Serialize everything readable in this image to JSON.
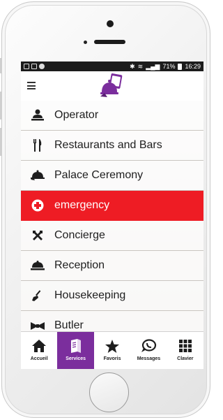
{
  "status_bar": {
    "battery": "71%",
    "time": "16:29"
  },
  "app": {
    "logo_icon": "concierge-bell-logo-icon",
    "accent_color": "#7b2e9d",
    "emergency_color": "#ee1c24"
  },
  "services": [
    {
      "label": "Operator",
      "icon": "operator-icon"
    },
    {
      "label": "Restaurants and Bars",
      "icon": "fork-knife-icon"
    },
    {
      "label": "Palace Ceremony",
      "icon": "serving-tray-icon"
    },
    {
      "label": "emergency",
      "icon": "medical-cross-icon",
      "active": true
    },
    {
      "label": "Concierge",
      "icon": "tools-icon"
    },
    {
      "label": "Reception",
      "icon": "bell-icon"
    },
    {
      "label": "Housekeeping",
      "icon": "broom-icon"
    },
    {
      "label": "Butler",
      "icon": "bow-tie-icon"
    }
  ],
  "tabs": [
    {
      "label": "Accueil",
      "icon": "home-icon"
    },
    {
      "label": "Services",
      "icon": "book-icon",
      "active": true
    },
    {
      "label": "Favoris",
      "icon": "star-icon"
    },
    {
      "label": "Messages",
      "icon": "chat-icon"
    },
    {
      "label": "Clavier",
      "icon": "keypad-icon"
    }
  ]
}
